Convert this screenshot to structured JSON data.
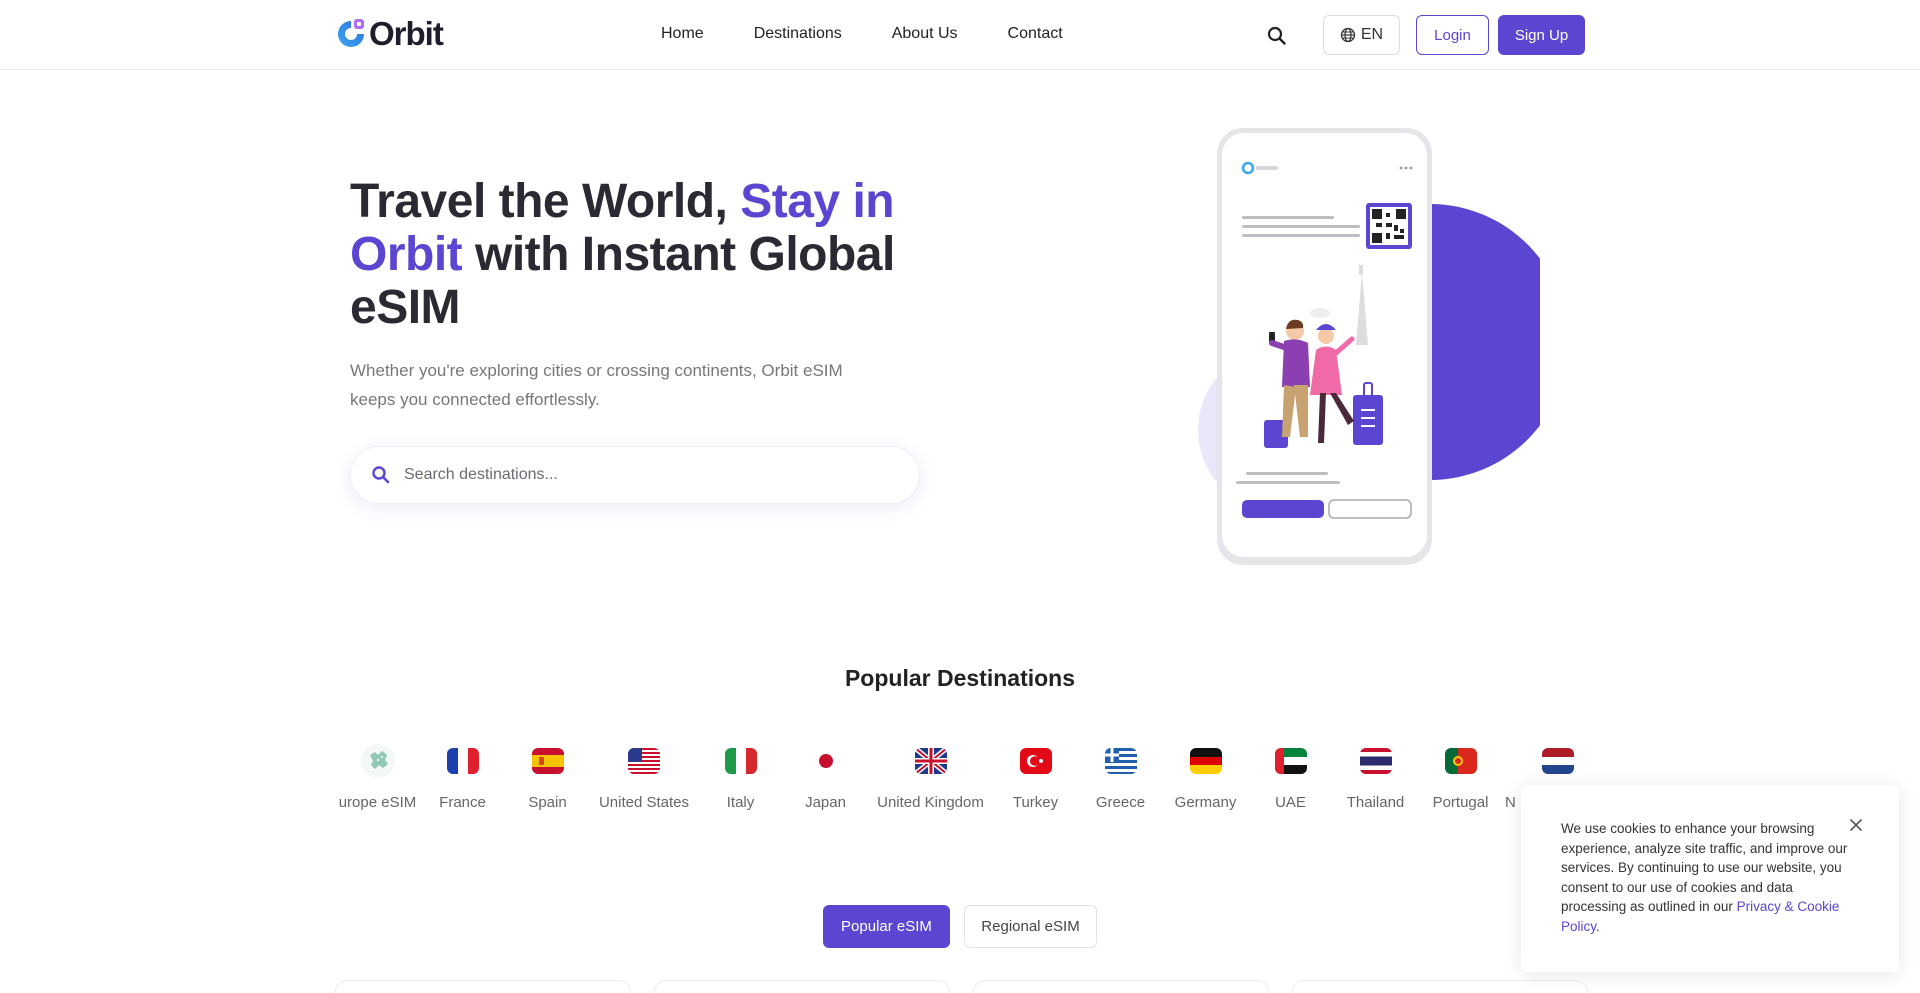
{
  "header": {
    "logo_text": "Orbit",
    "nav": [
      "Home",
      "Destinations",
      "About Us",
      "Contact"
    ],
    "language": "EN",
    "login_label": "Login",
    "signup_label": "Sign Up"
  },
  "hero": {
    "title_part1": "Travel the World, ",
    "title_accent": "Stay in Orbit",
    "title_part2": " with Instant Global eSIM",
    "subtitle": "Whether you're exploring cities or crossing continents, Orbit eSIM keeps you connected effortlessly.",
    "search_placeholder": "Search destinations..."
  },
  "popular": {
    "title": "Popular Destinations",
    "destinations": [
      {
        "label": "urope eSIM",
        "flag": "europe-map"
      },
      {
        "label": "France",
        "flag": "france"
      },
      {
        "label": "Spain",
        "flag": "spain"
      },
      {
        "label": "United States",
        "flag": "united-states"
      },
      {
        "label": "Italy",
        "flag": "italy"
      },
      {
        "label": "Japan",
        "flag": "japan"
      },
      {
        "label": "United Kingdom",
        "flag": "united-kingdom"
      },
      {
        "label": "Turkey",
        "flag": "turkey"
      },
      {
        "label": "Greece",
        "flag": "greece"
      },
      {
        "label": "Germany",
        "flag": "germany"
      },
      {
        "label": "UAE",
        "flag": "uae"
      },
      {
        "label": "Thailand",
        "flag": "thailand"
      },
      {
        "label": "Portugal",
        "flag": "portugal"
      },
      {
        "label": "N",
        "flag": "netherlands"
      }
    ]
  },
  "tabs": {
    "active": "Popular eSIM",
    "inactive": "Regional eSIM"
  },
  "cookie": {
    "text": "We use cookies to enhance your browsing experience, analyze site traffic, and improve our services. By continuing to use our website, you consent to our use of cookies and data processing as outlined in our ",
    "link": "Privacy & Cookie Policy",
    "suffix": "."
  },
  "colors": {
    "accent": "#5b46d1",
    "accent_light": "#ebe7fb",
    "text_dark": "#2a2a33"
  }
}
